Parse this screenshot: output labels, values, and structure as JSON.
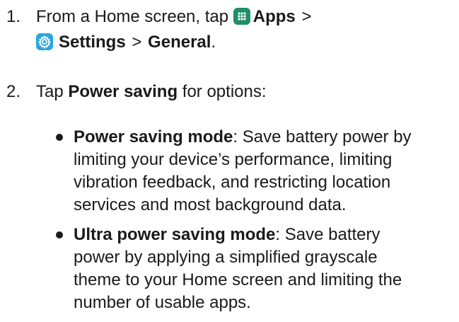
{
  "steps": [
    {
      "num": "1.",
      "prefix": "From a Home screen, tap",
      "apps_label": "Apps",
      "sep1": ">",
      "settings_label": "Settings",
      "sep2": ">",
      "general_label": "General",
      "end": "."
    },
    {
      "num": "2.",
      "prefix": "Tap",
      "bold": "Power saving",
      "suffix": "for options:"
    }
  ],
  "bullets": [
    {
      "title": "Power saving mode",
      "colon": ":",
      "lines": [
        "Save battery power by",
        "limiting your device’s performance, limiting",
        "vibration feedback, and restricting location",
        "services and most background data."
      ]
    },
    {
      "title": "Ultra power saving mode",
      "colon": ":",
      "lines": [
        "Save battery",
        "power by applying a simplified grayscale",
        "theme to your Home screen and limiting the",
        "number of usable apps."
      ]
    }
  ],
  "icons": {
    "apps": "apps-grid-icon",
    "settings": "settings-gear-icon"
  },
  "colors": {
    "apps_icon": "#1e8f6a",
    "settings_icon": "#29a6e0",
    "text": "#1a1a1a"
  }
}
